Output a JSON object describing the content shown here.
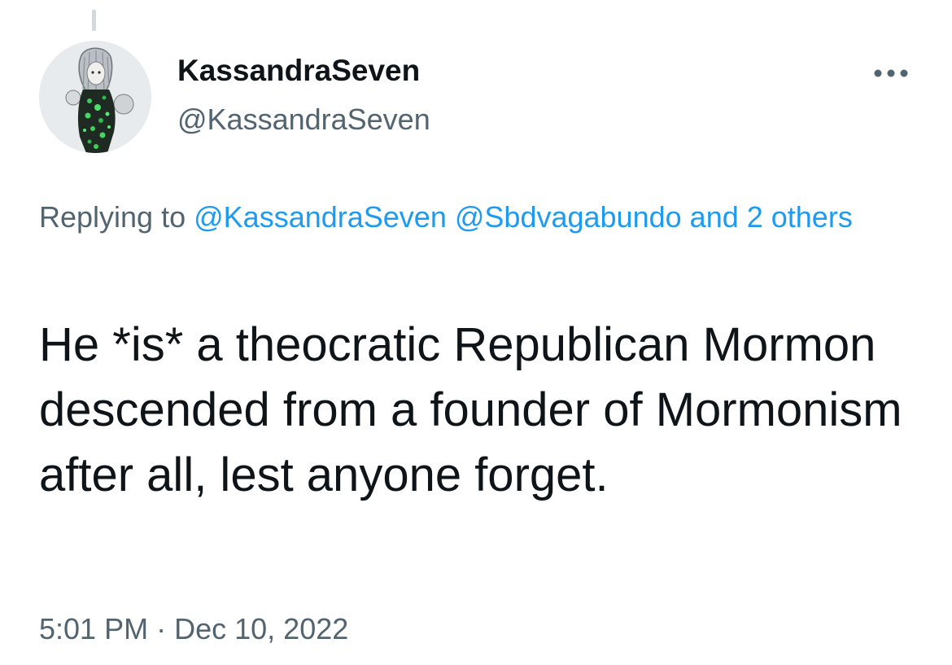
{
  "tweet": {
    "author": {
      "display_name": "KassandraSeven",
      "handle": "@KassandraSeven",
      "avatar_icon": "avatar-illustration"
    },
    "more_icon": "more-options-icon",
    "reply": {
      "prefix": "Replying to",
      "mentions": [
        "@KassandraSeven",
        "@Sbdvagabundo"
      ],
      "others_label": "and 2 others"
    },
    "text": "He *is* a theocratic Republican Mormon descended from a founder of Mormonism after all, lest anyone forget.",
    "time": "5:01 PM",
    "separator": "·",
    "date": "Dec 10, 2022"
  },
  "colors": {
    "text_primary": "#0f1419",
    "text_secondary": "#536471",
    "link": "#1d9bf0"
  }
}
